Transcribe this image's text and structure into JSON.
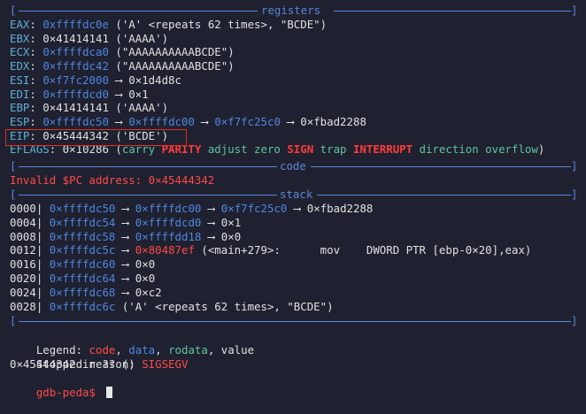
{
  "sections": {
    "registers": "registers",
    "code": "code",
    "stack": "stack"
  },
  "registers": [
    {
      "name": "EAX",
      "parts": [
        [
          "cyan",
          "EAX"
        ],
        [
          "white",
          ": "
        ],
        [
          "blue",
          "0xffffdc0e"
        ],
        [
          "white",
          " ('A' <repeats 62 times>, \"BCDE\")"
        ]
      ]
    },
    {
      "name": "EBX",
      "parts": [
        [
          "cyan",
          "EBX"
        ],
        [
          "white",
          ": 0×41414141 ('AAAA')"
        ]
      ]
    },
    {
      "name": "ECX",
      "parts": [
        [
          "cyan",
          "ECX"
        ],
        [
          "white",
          ": "
        ],
        [
          "blue",
          "0×ffffdca0"
        ],
        [
          "white",
          " (\"AAAAAAAAAABCDE\")"
        ]
      ]
    },
    {
      "name": "EDX",
      "parts": [
        [
          "cyan",
          "EDX"
        ],
        [
          "white",
          ": "
        ],
        [
          "blue",
          "0×ffffdc42"
        ],
        [
          "white",
          " (\"AAAAAAAAAABCDE\")"
        ]
      ]
    },
    {
      "name": "ESI",
      "parts": [
        [
          "cyan",
          "ESI"
        ],
        [
          "white",
          ": "
        ],
        [
          "blue",
          "0×f7fc2000"
        ],
        [
          "white",
          " ⟶ 0×1d4d8c"
        ]
      ]
    },
    {
      "name": "EDI",
      "parts": [
        [
          "cyan",
          "EDI"
        ],
        [
          "white",
          ": "
        ],
        [
          "blue",
          "0×ffffdcd0"
        ],
        [
          "white",
          " ⟶ 0×1"
        ]
      ]
    },
    {
      "name": "EBP",
      "parts": [
        [
          "cyan",
          "EBP"
        ],
        [
          "white",
          ": 0×41414141 ('AAAA')"
        ]
      ]
    },
    {
      "name": "ESP",
      "parts": [
        [
          "cyan",
          "ESP"
        ],
        [
          "white",
          ": "
        ],
        [
          "blue",
          "0×ffffdc50"
        ],
        [
          "white",
          " ⟶ "
        ],
        [
          "blue",
          "0×ffffdc00"
        ],
        [
          "white",
          " ⟶ "
        ],
        [
          "blue",
          "0×f7fc25c0"
        ],
        [
          "white",
          " ⟶ 0×fbad2288"
        ]
      ]
    },
    {
      "name": "EIP",
      "parts": [
        [
          "cyan",
          "EIP"
        ],
        [
          "white",
          ": 0×45444342 ('BCDE')"
        ]
      ]
    },
    {
      "name": "EFLAGS",
      "parts": [
        [
          "cyan",
          "EFLAGS"
        ],
        [
          "white",
          ": 0×10286 ("
        ],
        [
          "green",
          "carry "
        ],
        [
          "redb",
          "PARITY"
        ],
        [
          "green",
          " adjust zero "
        ],
        [
          "redb",
          "SIGN"
        ],
        [
          "green",
          " trap "
        ],
        [
          "redb",
          "INTERRUPT"
        ],
        [
          "green",
          " direction overflow"
        ],
        [
          "white",
          ")"
        ]
      ]
    }
  ],
  "code_message": "Invalid $PC address: 0×45444342",
  "stack": [
    {
      "offset": "0000|",
      "parts": [
        [
          "blue",
          "0×ffffdc50"
        ],
        [
          "white",
          " ⟶ "
        ],
        [
          "blue",
          "0×ffffdc00"
        ],
        [
          "white",
          " ⟶ "
        ],
        [
          "blue",
          "0×f7fc25c0"
        ],
        [
          "white",
          " ⟶ 0×fbad2288"
        ]
      ]
    },
    {
      "offset": "0004|",
      "parts": [
        [
          "blue",
          "0×ffffdc54"
        ],
        [
          "white",
          " ⟶ "
        ],
        [
          "blue",
          "0×ffffdcd0"
        ],
        [
          "white",
          " ⟶ 0×1"
        ]
      ]
    },
    {
      "offset": "0008|",
      "parts": [
        [
          "blue",
          "0×ffffdc58"
        ],
        [
          "white",
          " ⟶ "
        ],
        [
          "blue",
          "0×ffffdd18"
        ],
        [
          "white",
          " ⟶ 0×0"
        ]
      ]
    },
    {
      "offset": "0012|",
      "parts": [
        [
          "blue",
          "0×ffffdc5c"
        ],
        [
          "white",
          " ⟶ "
        ],
        [
          "red",
          "0×80487ef"
        ],
        [
          "white",
          " (<main+279>:      mov    DWORD PTR [ebp-0×20],eax)"
        ]
      ]
    },
    {
      "offset": "0016|",
      "parts": [
        [
          "blue",
          "0×ffffdc60"
        ],
        [
          "white",
          " ⟶ 0×0"
        ]
      ]
    },
    {
      "offset": "0020|",
      "parts": [
        [
          "blue",
          "0×ffffdc64"
        ],
        [
          "white",
          " ⟶ 0×0"
        ]
      ]
    },
    {
      "offset": "0024|",
      "parts": [
        [
          "blue",
          "0×ffffdc68"
        ],
        [
          "white",
          " ⟶ 0×c2"
        ]
      ]
    },
    {
      "offset": "0028|",
      "parts": [
        [
          "blue",
          "0×ffffdc6c"
        ],
        [
          "white",
          " ('A' <repeats 62 times>, \"BCDE\")"
        ]
      ]
    }
  ],
  "legend": {
    "label": "Legend: ",
    "items": [
      [
        "red",
        "code"
      ],
      [
        "white",
        ", "
      ],
      [
        "blue",
        "data"
      ],
      [
        "white",
        ", "
      ],
      [
        "green",
        "rodata"
      ],
      [
        "white",
        ", value"
      ]
    ]
  },
  "stopped": {
    "label": "Stopped reason: ",
    "value": "SIGSEGV"
  },
  "location": "0×45444342 in ?? ()",
  "prompt": "gdb-peda$ ",
  "colors": {
    "background": "#1f2130",
    "rule": "#5a86d8",
    "highlight_box": "#e0301e"
  }
}
